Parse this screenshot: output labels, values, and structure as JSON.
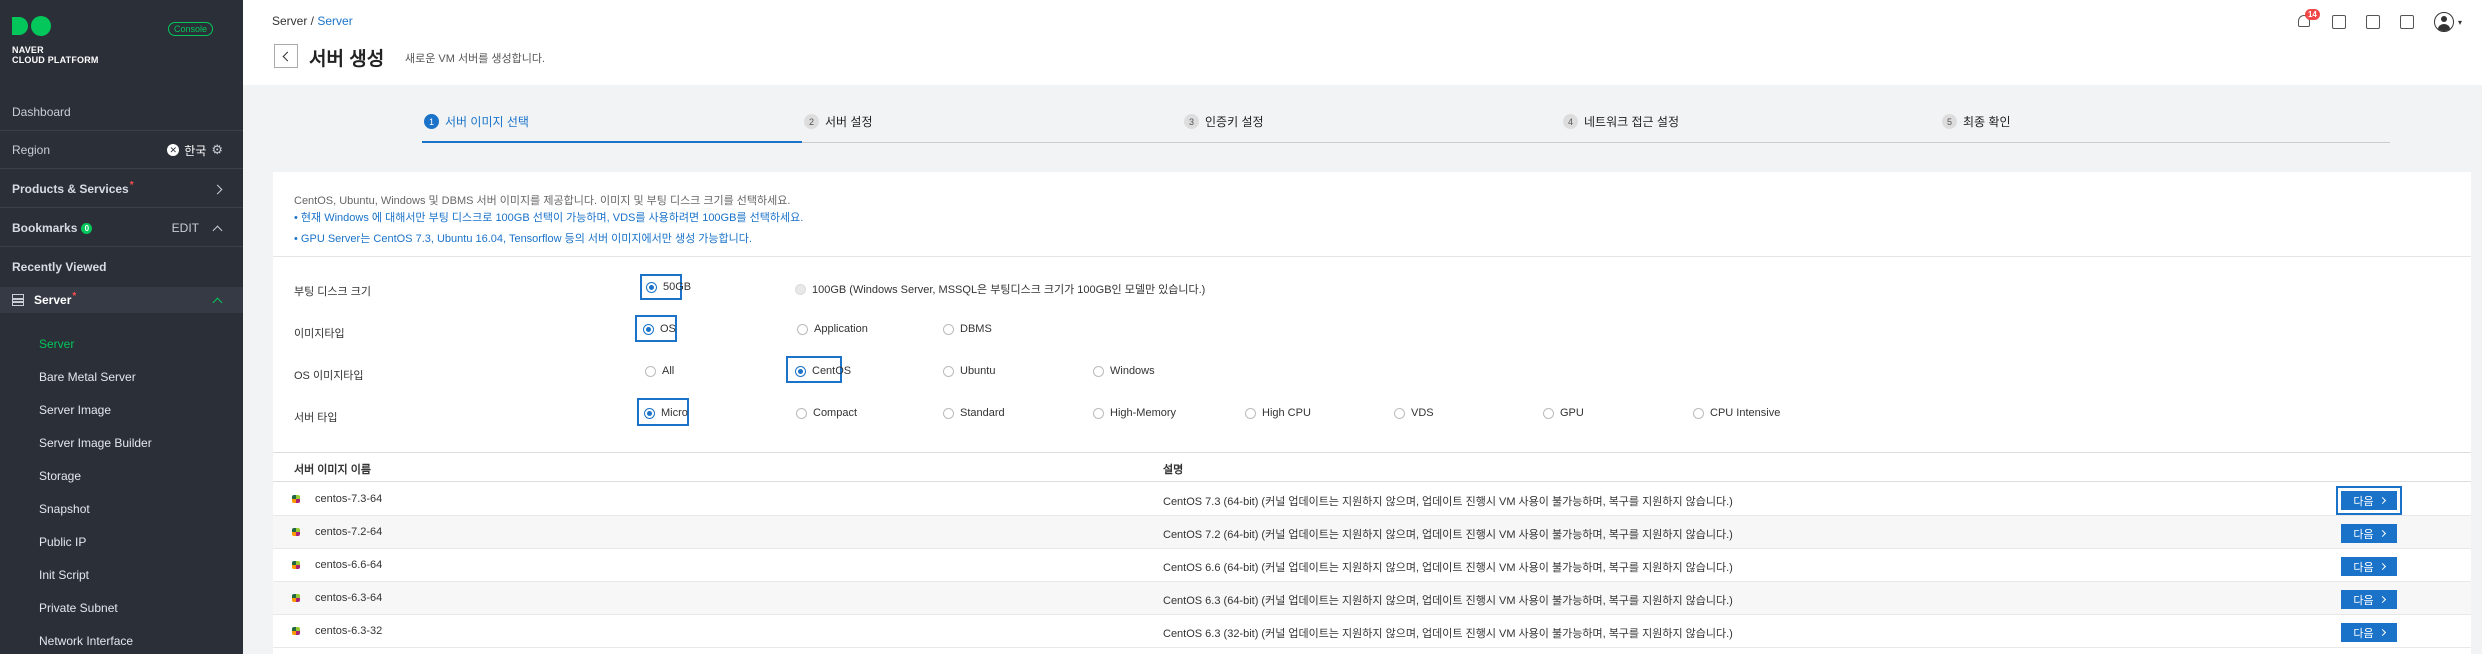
{
  "sidebar": {
    "logo_text_line1": "NAVER",
    "logo_text_line2": "CLOUD PLATFORM",
    "console_badge": "Console",
    "dashboard": "Dashboard",
    "region_label": "Region",
    "region_value": "한국",
    "products_label": "Products & Services",
    "required_mark": "*",
    "bookmarks_label": "Bookmarks",
    "bookmarks_count": "0",
    "bookmarks_edit": "EDIT",
    "recently_viewed": "Recently Viewed",
    "server_label": "Server",
    "items": [
      {
        "label": "Server"
      },
      {
        "label": "Bare Metal Server"
      },
      {
        "label": "Server Image"
      },
      {
        "label": "Server Image Builder"
      },
      {
        "label": "Storage"
      },
      {
        "label": "Snapshot"
      },
      {
        "label": "Public IP"
      },
      {
        "label": "Init Script"
      },
      {
        "label": "Private Subnet"
      },
      {
        "label": "Network Interface"
      }
    ]
  },
  "header": {
    "crumb_root": "Server /",
    "crumb_current": "Server",
    "title": "서버 생성",
    "description": "새로운 VM 서버를 생성합니다.",
    "notification_count": "14",
    "caret": "▾"
  },
  "steps": [
    {
      "num": "1",
      "label": "서버 이미지 선택"
    },
    {
      "num": "2",
      "label": "서버 설정"
    },
    {
      "num": "3",
      "label": "인증키 설정"
    },
    {
      "num": "4",
      "label": "네트워크 접근 설정"
    },
    {
      "num": "5",
      "label": "최종 확인"
    }
  ],
  "notice": {
    "main": "CentOS, Ubuntu, Windows 및 DBMS 서버 이미지를 제공합니다. 이미지 및 부팅 디스크 크기를 선택하세요.",
    "line1": "현재 Windows 에 대해서만 부팅 디스크로 100GB 선택이 가능하며, VDS를 사용하려면 100GB를 선택하세요.",
    "line2": "GPU Server는 CentOS 7.3, Ubuntu 16.04, Tensorflow 등의 서버 이미지에서만 생성 가능합니다."
  },
  "options": {
    "boot_disk": {
      "label": "부팅 디스크 크기",
      "choices": [
        "50GB",
        "100GB (Windows Server, MSSQL은 부팅디스크 크기가 100GB인 모델만 있습니다.)"
      ]
    },
    "image_type": {
      "label": "이미지타입",
      "choices": [
        "OS",
        "Application",
        "DBMS"
      ]
    },
    "os_image_type": {
      "label": "OS 이미지타입",
      "choices": [
        "All",
        "CentOS",
        "Ubuntu",
        "Windows"
      ]
    },
    "server_type": {
      "label": "서버 타입",
      "choices": [
        "Micro",
        "Compact",
        "Standard",
        "High-Memory",
        "High CPU",
        "VDS",
        "GPU",
        "CPU Intensive"
      ]
    }
  },
  "table": {
    "col_name": "서버 이미지 이름",
    "col_desc": "설명",
    "next_label": "다음",
    "rows": [
      {
        "name": "centos-7.3-64",
        "desc": "CentOS 7.3 (64-bit) (커널 업데이트는 지원하지 않으며, 업데이트 진행시 VM 사용이 불가능하며, 복구를 지원하지 않습니다.)"
      },
      {
        "name": "centos-7.2-64",
        "desc": "CentOS 7.2 (64-bit) (커널 업데이트는 지원하지 않으며, 업데이트 진행시 VM 사용이 불가능하며, 복구를 지원하지 않습니다.)"
      },
      {
        "name": "centos-6.6-64",
        "desc": "CentOS 6.6 (64-bit) (커널 업데이트는 지원하지 않으며, 업데이트 진행시 VM 사용이 불가능하며, 복구를 지원하지 않습니다.)"
      },
      {
        "name": "centos-6.3-64",
        "desc": "CentOS 6.3 (64-bit) (커널 업데이트는 지원하지 않으며, 업데이트 진행시 VM 사용이 불가능하며, 복구를 지원하지 않습니다.)"
      },
      {
        "name": "centos-6.3-32",
        "desc": "CentOS 6.3 (32-bit) (커널 업데이트는 지원하지 않으며, 업데이트 진행시 VM 사용이 불가능하며, 복구를 지원하지 않습니다.)"
      }
    ]
  },
  "colors": {
    "accent": "#1a73c9",
    "brand": "#03c75a",
    "sidebar_bg": "#2b2f38"
  }
}
